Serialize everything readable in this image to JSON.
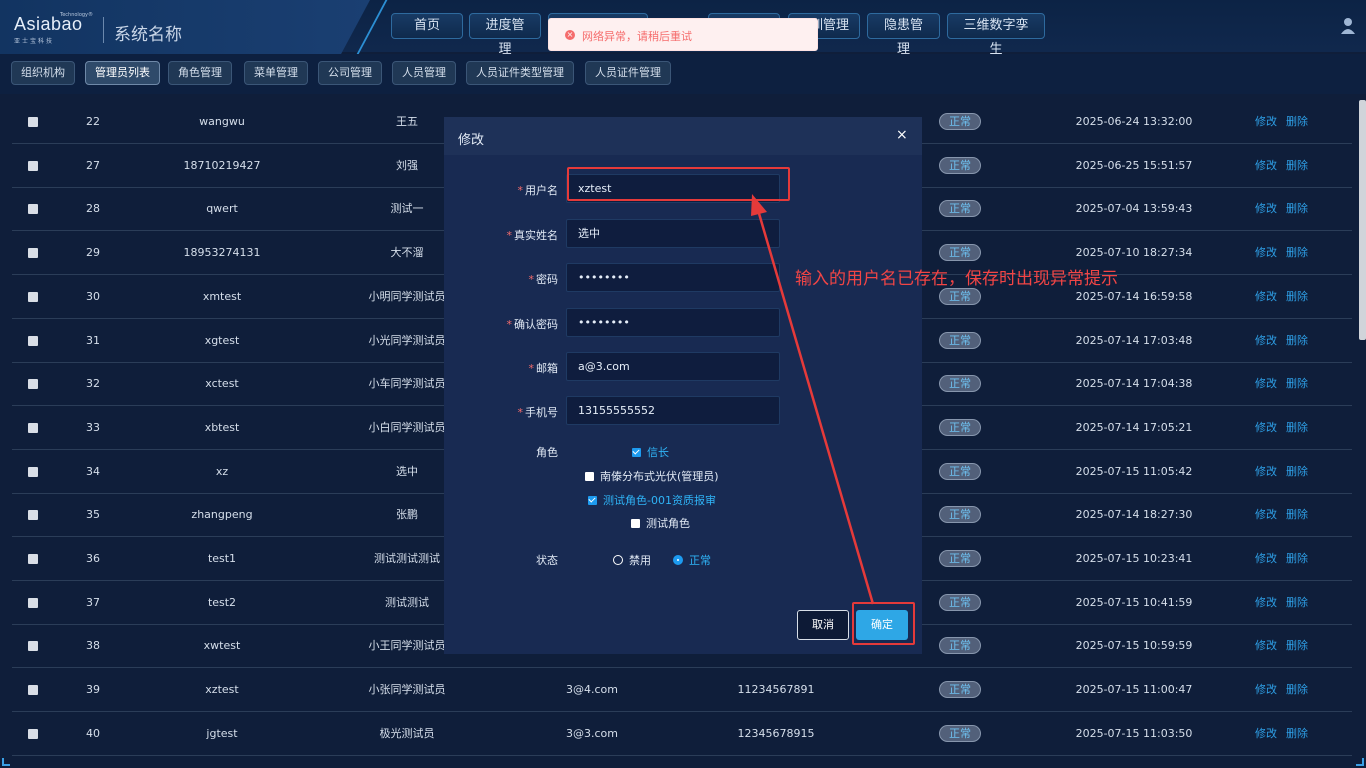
{
  "header": {
    "logo_text": "Asiabao",
    "logo_tm": "Technology®",
    "logo_sub": "亚士宝科技",
    "system_name": "系统名称",
    "nav": [
      "首页",
      "进度管理",
      "",
      "",
      "训管理",
      "隐患管理",
      "三维数字孪生"
    ]
  },
  "toast": {
    "message": "网络异常，请稍后重试"
  },
  "subnav": [
    "组织机构",
    "管理员列表",
    "角色管理",
    "菜单管理",
    "公司管理",
    "人员管理",
    "人员证件类型管理",
    "人员证件管理"
  ],
  "table": {
    "rows": [
      {
        "id": "22",
        "username": "wangwu",
        "realname": "王五",
        "email": "",
        "phone": "",
        "status": "正常",
        "created": "2025-06-24 13:32:00"
      },
      {
        "id": "27",
        "username": "18710219427",
        "realname": "刘强",
        "email": "",
        "phone": "",
        "status": "正常",
        "created": "2025-06-25 15:51:57"
      },
      {
        "id": "28",
        "username": "qwert",
        "realname": "测试一",
        "email": "",
        "phone": "",
        "status": "正常",
        "created": "2025-07-04 13:59:43"
      },
      {
        "id": "29",
        "username": "18953274131",
        "realname": "大不溜",
        "email": "",
        "phone": "",
        "status": "正常",
        "created": "2025-07-10 18:27:34"
      },
      {
        "id": "30",
        "username": "xmtest",
        "realname": "小明同学测试员",
        "email": "",
        "phone": "",
        "status": "正常",
        "created": "2025-07-14 16:59:58"
      },
      {
        "id": "31",
        "username": "xgtest",
        "realname": "小光同学测试员",
        "email": "",
        "phone": "",
        "status": "正常",
        "created": "2025-07-14 17:03:48"
      },
      {
        "id": "32",
        "username": "xctest",
        "realname": "小车同学测试员",
        "email": "",
        "phone": "",
        "status": "正常",
        "created": "2025-07-14 17:04:38"
      },
      {
        "id": "33",
        "username": "xbtest",
        "realname": "小白同学测试员",
        "email": "",
        "phone": "",
        "status": "正常",
        "created": "2025-07-14 17:05:21"
      },
      {
        "id": "34",
        "username": "xz",
        "realname": "选中",
        "email": "",
        "phone": "",
        "status": "正常",
        "created": "2025-07-15 11:05:42"
      },
      {
        "id": "35",
        "username": "zhangpeng",
        "realname": "张鹏",
        "email": "",
        "phone": "",
        "status": "正常",
        "created": "2025-07-14 18:27:30"
      },
      {
        "id": "36",
        "username": "test1",
        "realname": "测试测试测试",
        "email": "",
        "phone": "",
        "status": "正常",
        "created": "2025-07-15 10:23:41"
      },
      {
        "id": "37",
        "username": "test2",
        "realname": "测试测试",
        "email": "",
        "phone": "",
        "status": "正常",
        "created": "2025-07-15 10:41:59"
      },
      {
        "id": "38",
        "username": "xwtest",
        "realname": "小王同学测试员",
        "email": "",
        "phone": "",
        "status": "正常",
        "created": "2025-07-15 10:59:59"
      },
      {
        "id": "39",
        "username": "xztest",
        "realname": "小张同学测试员",
        "email": "3@4.com",
        "phone": "11234567891",
        "status": "正常",
        "created": "2025-07-15 11:00:47"
      },
      {
        "id": "40",
        "username": "jgtest",
        "realname": "极光测试员",
        "email": "3@3.com",
        "phone": "12345678915",
        "status": "正常",
        "created": "2025-07-15 11:03:50"
      }
    ],
    "edit_label": "修改",
    "delete_label": "删除"
  },
  "dialog": {
    "title": "修改",
    "close": "×",
    "fields": [
      {
        "label": "用户名",
        "value": "xztest"
      },
      {
        "label": "真实姓名",
        "value": "选中"
      },
      {
        "label": "密码",
        "value": "••••••••"
      },
      {
        "label": "确认密码",
        "value": "••••••••"
      },
      {
        "label": "邮箱",
        "value": "a@3.com"
      },
      {
        "label": "手机号",
        "value": "13155555552"
      }
    ],
    "role_label": "角色",
    "roles": [
      {
        "label": "信长",
        "checked": true
      },
      {
        "label": "南傣分布式光伏(管理员)",
        "checked": false
      },
      {
        "label": "测试角色-001资质报审",
        "checked": true
      },
      {
        "label": "测试角色",
        "checked": false
      }
    ],
    "status_label": "状态",
    "status_options": [
      {
        "label": "禁用",
        "selected": false
      },
      {
        "label": "正常",
        "selected": true
      }
    ],
    "cancel_label": "取消",
    "ok_label": "确定"
  },
  "annotation": {
    "text": "输入的用户名已存在，保存时出现异常提示"
  },
  "colors": {
    "accent": "#2ea7e6",
    "error": "#f56c6c",
    "annotation": "#e53a3a",
    "background": "#0f1e3a"
  }
}
